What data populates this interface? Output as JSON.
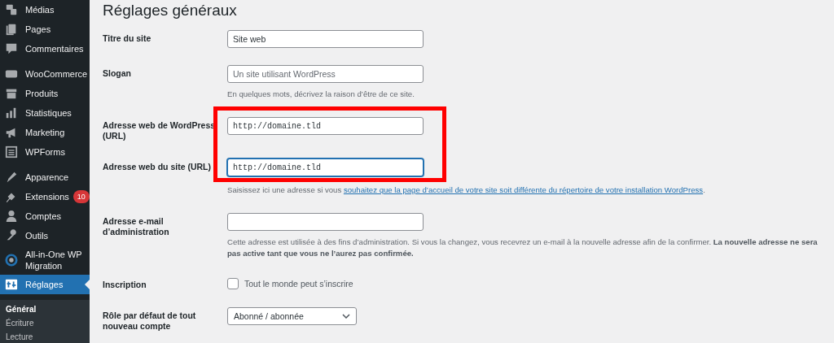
{
  "sidebar": {
    "groups": [
      {
        "items": [
          {
            "label": "Médias",
            "selected": false
          },
          {
            "label": "Pages",
            "selected": false
          },
          {
            "label": "Commentaires",
            "selected": false
          }
        ]
      },
      {
        "items": [
          {
            "label": "WooCommerce",
            "selected": false
          },
          {
            "label": "Produits",
            "selected": false
          },
          {
            "label": "Statistiques",
            "selected": false
          },
          {
            "label": "Marketing",
            "selected": false
          },
          {
            "label": "WPForms",
            "selected": false
          }
        ]
      },
      {
        "items": [
          {
            "label": "Apparence",
            "selected": false
          },
          {
            "label": "Extensions",
            "selected": false,
            "badge": "10"
          },
          {
            "label": "Comptes",
            "selected": false
          },
          {
            "label": "Outils",
            "selected": false
          },
          {
            "label": "All-in-One WP Migration",
            "selected": false
          },
          {
            "label": "Réglages",
            "selected": true
          }
        ]
      }
    ],
    "submenu": [
      {
        "label": "Général",
        "selected": true
      },
      {
        "label": "Écriture",
        "selected": false
      },
      {
        "label": "Lecture",
        "selected": false
      }
    ]
  },
  "page": {
    "title": "Réglages généraux",
    "fields": [
      {
        "kind": "text",
        "label": "Titre du site",
        "value": "Site web",
        "focused": false,
        "highlighted": false
      },
      {
        "kind": "text",
        "label": "Slogan",
        "placeholder": "Un site utilisant WordPress",
        "description": "En quelques mots, décrivez la raison d’être de ce site.",
        "focused": false,
        "highlighted": false
      },
      {
        "kind": "url",
        "label": "Adresse web de WordPress (URL)",
        "value": "http://domaine.tld",
        "focused": false,
        "highlighted": true
      },
      {
        "kind": "url",
        "label": "Adresse web du site (URL)",
        "value": "http://domaine.tld",
        "focused": true,
        "highlighted": true,
        "description_before": "Saisissez ici une adresse si vous ",
        "description_link": "souhaitez que la page d’accueil de votre site soit différente du répertoire de votre installation WordPress",
        "description_after": "."
      },
      {
        "kind": "email",
        "label": "Adresse e-mail d’administration",
        "focused": false,
        "highlighted": false,
        "description": "Cette adresse est utilisée à des fins d’administration. Si vous la changez, vous recevrez un e-mail à la nouvelle adresse afin de la confirmer. **La nouvelle adresse ne sera pas active tant que vous ne l’aurez pas confirmée.**"
      },
      {
        "kind": "checkbox",
        "label": "Inscription",
        "option": "Tout le monde peut s’inscrire",
        "checked": false
      },
      {
        "kind": "select",
        "label": "Rôle par défaut de tout nouveau compte",
        "value": "Abonné / abonnée"
      }
    ]
  }
}
